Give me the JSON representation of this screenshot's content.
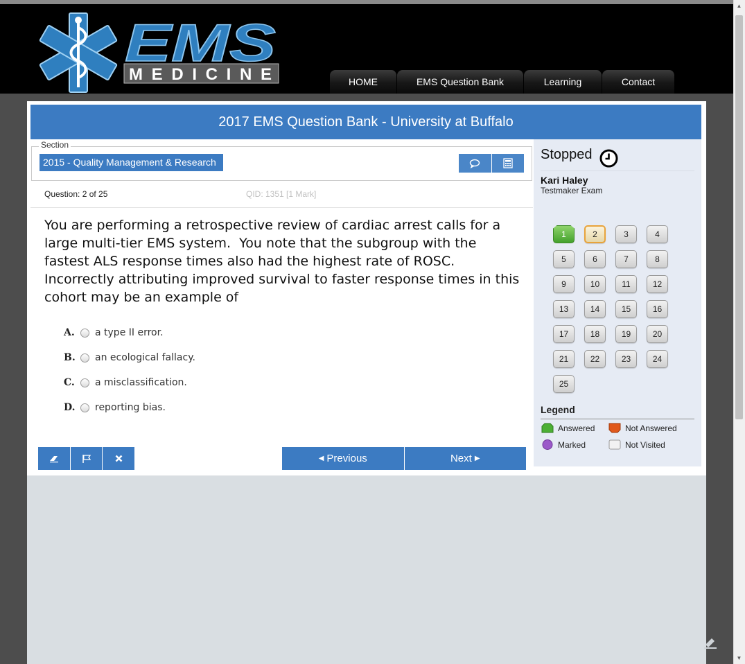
{
  "header": {
    "logo_top": "EMS",
    "logo_bottom": "MEDICINE",
    "nav": [
      "HOME",
      "EMS Question Bank",
      "Learning",
      "Contact"
    ]
  },
  "title": "2017 EMS Question Bank - University at Buffalo",
  "section": {
    "legend": "Section",
    "name": "2015 - Quality Management & Research"
  },
  "question": {
    "counter": "Question: 2 of 25",
    "qid": "QID: 1351  [1 Mark]",
    "text": "You are performing a retrospective review of cardiac arrest calls for a large multi-tier EMS system.  You note that the subgroup with the fastest ALS response times also had the highest rate of ROSC.  Incorrectly attributing improved survival to faster response times in this cohort may be an example of",
    "options": [
      {
        "letter": "A.",
        "text": "a type II error."
      },
      {
        "letter": "B.",
        "text": "an ecological fallacy."
      },
      {
        "letter": "C.",
        "text": "a misclassification."
      },
      {
        "letter": "D.",
        "text": "reporting bias."
      }
    ]
  },
  "buttons": {
    "previous": "Previous",
    "next": "Next"
  },
  "sidebar": {
    "status": "Stopped",
    "user": "Kari Haley",
    "exam": "Testmaker Exam",
    "questions": [
      "1",
      "2",
      "3",
      "4",
      "5",
      "6",
      "7",
      "8",
      "9",
      "10",
      "11",
      "12",
      "13",
      "14",
      "15",
      "16",
      "17",
      "18",
      "19",
      "20",
      "21",
      "22",
      "23",
      "24",
      "25"
    ],
    "answered": [
      1
    ],
    "current": 2,
    "legend_title": "Legend",
    "legend": {
      "answered": "Answered",
      "not_answered": "Not Answered",
      "marked": "Marked",
      "not_visited": "Not Visited"
    }
  },
  "colors": {
    "primary": "#3c7bc2",
    "answered": "#43a12c",
    "not_answered": "#e0591c",
    "marked": "#9b59c9",
    "current_border": "#e8a33b"
  },
  "icons": [
    "comment-icon",
    "calculator-icon",
    "eraser-icon",
    "flag-icon",
    "close-icon",
    "clock-icon"
  ]
}
